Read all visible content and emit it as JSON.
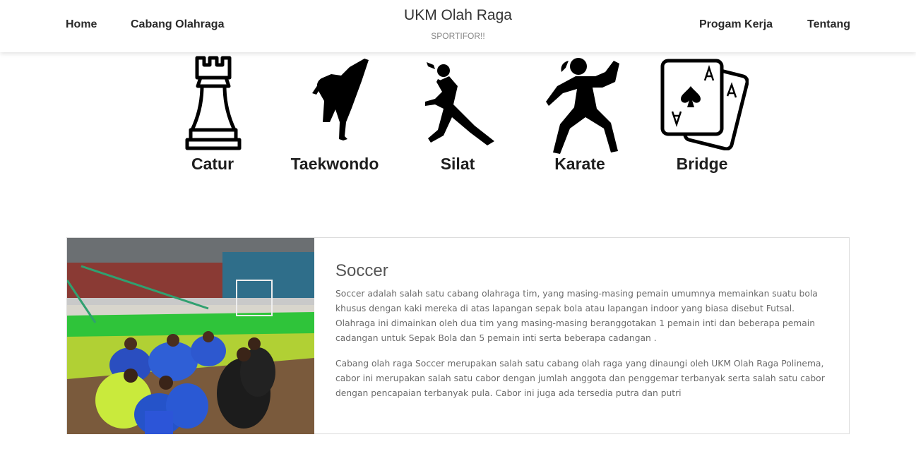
{
  "header": {
    "nav_left": [
      "Home",
      "Cabang Olahraga"
    ],
    "nav_right": [
      "Progam Kerja",
      "Tentang"
    ],
    "title": "UKM Olah Raga",
    "subtitle": "SPORTIFOR!!"
  },
  "sports": [
    {
      "label": "Catur",
      "icon": "chess-rook-icon"
    },
    {
      "label": "Taekwondo",
      "icon": "taekwondo-kick-icon"
    },
    {
      "label": "Silat",
      "icon": "silat-stance-icon"
    },
    {
      "label": "Karate",
      "icon": "karate-stance-icon"
    },
    {
      "label": "Bridge",
      "icon": "playing-cards-icon"
    }
  ],
  "card": {
    "title": "Soccer",
    "paragraphs": [
      "Soccer adalah salah satu cabang olahraga tim, yang masing-masing pemain umumnya memainkan suatu bola khusus dengan kaki mereka di atas lapangan sepak bola atau lapangan indoor yang biasa disebut Futsal. Olahraga ini dimainkan oleh dua tim yang masing-masing beranggotakan 1 pemain inti dan beberapa pemain cadangan untuk Sepak Bola dan 5 pemain inti serta beberapa cadangan .",
      "Cabang olah raga Soccer merupakan salah satu cabang olah raga yang dinaungi oleh UKM Olah Raga Polinema, cabor ini merupakan salah satu cabor dengan jumlah anggota dan penggemar terbanyak serta salah satu cabor dengan pencapaian terbanyak pula. Cabor ini juga ada tersedia putra dan putri"
    ]
  }
}
